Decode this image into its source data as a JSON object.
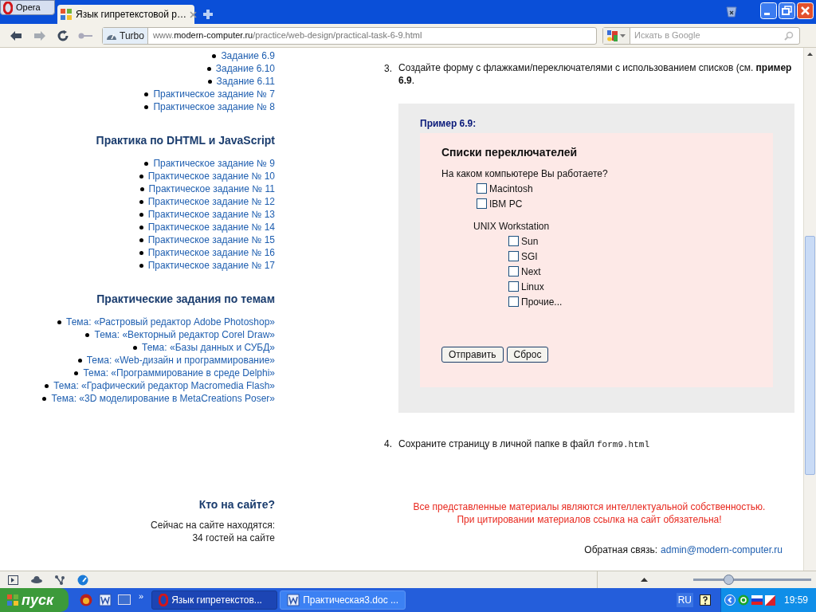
{
  "browser": {
    "menu_button": "Opera",
    "tabs": [
      {
        "title": "Язык гипретекстовой р…",
        "selected": true
      }
    ],
    "turbo": "Turbo",
    "address": {
      "prefix": "www.",
      "domain": "modern-computer.ru",
      "path": "/practice/web-design/practical-task-6-9.html"
    },
    "search": {
      "placeholder": "Искать в Google"
    }
  },
  "sidebar": {
    "sections": [
      {
        "items": [
          {
            "children": [
              {
                "text": "Задание 6.9"
              },
              {
                "text": "Задание 6.10"
              },
              {
                "text": "Задание 6.11"
              }
            ]
          },
          {
            "text": "Практическое задание № 7"
          },
          {
            "text": "Практическое задание № 8"
          }
        ]
      },
      {
        "heading": "Практика по DHTML и JavaScript",
        "items": [
          {
            "text": "Практическое задание № 9"
          },
          {
            "text": "Практическое задание № 10"
          },
          {
            "text": "Практическое задание № 11"
          },
          {
            "text": "Практическое задание № 12"
          },
          {
            "text": "Практическое задание № 13"
          },
          {
            "text": "Практическое задание № 14"
          },
          {
            "text": "Практическое задание № 15"
          },
          {
            "text": "Практическое задание № 16"
          },
          {
            "text": "Практическое задание № 17"
          }
        ]
      },
      {
        "heading": "Практические задания по темам",
        "items": [
          {
            "text": "Тема: «Растровый редактор Adobe Photoshop»"
          },
          {
            "text": "Тема: «Векторный редактор Corel Draw»"
          },
          {
            "text": "Тема: «Базы данных и СУБД»"
          },
          {
            "text": "Тема: «Web-дизайн и программирование»"
          },
          {
            "text": "Тема: «Программирование в среде Delphi»"
          },
          {
            "text": "Тема: «Графический редактор Macromedia Flash»"
          },
          {
            "text": "Тема: «3D моделирование в MetaCreations Poser»"
          }
        ]
      }
    ],
    "online": {
      "heading": "Кто на сайте?",
      "lines": [
        "Сейчас на сайте находятся:",
        "34 гостей на сайте"
      ]
    }
  },
  "main": {
    "task3": {
      "number": "3.",
      "text": "Создайте форму с флажками/переключателями с использованием списков (см. **пример 6.9**."
    },
    "example": {
      "caption": "Пример 6.9:",
      "heading": "Списки переключателей",
      "question": "На каком компьютере Вы работаете?",
      "items": [
        {
          "kind": "checkbox",
          "label": "Macintosh",
          "checked": false
        },
        {
          "kind": "checkbox",
          "label": "IBM PC",
          "checked": false
        },
        {
          "kind": "group",
          "label": "UNIX Workstation",
          "children": [
            {
              "kind": "checkbox",
              "label": "Sun",
              "checked": false
            },
            {
              "kind": "checkbox",
              "label": "SGI",
              "checked": false
            },
            {
              "kind": "checkbox",
              "label": "Next",
              "checked": false
            },
            {
              "kind": "checkbox",
              "label": "Linux",
              "checked": false
            },
            {
              "kind": "checkbox",
              "label": "Прочие...",
              "checked": false
            }
          ]
        }
      ],
      "buttons": [
        "Отправить",
        "Сброс"
      ]
    },
    "task4": {
      "number": "4.",
      "text": "Сохраните страницу в личной папке в файл",
      "code": "form9.html"
    },
    "notice": [
      "Все представленные материалы являются интеллектуальной собственностью.",
      "При цитировании материалов ссылка на сайт обязательна!"
    ],
    "feedback": {
      "label": "Обратная связь:",
      "email": "admin@modern-computer.ru"
    }
  },
  "status_bar": {
    "zoom": {
      "level": 0.29
    }
  },
  "taskbar": {
    "start": "пуск",
    "more": "»",
    "tasks": [
      {
        "title": "Язык гипретекстов...",
        "selected": true
      },
      {
        "title": "Практическая3.doc ...",
        "selected": false
      }
    ],
    "language": "RU",
    "clock": "19:59"
  }
}
